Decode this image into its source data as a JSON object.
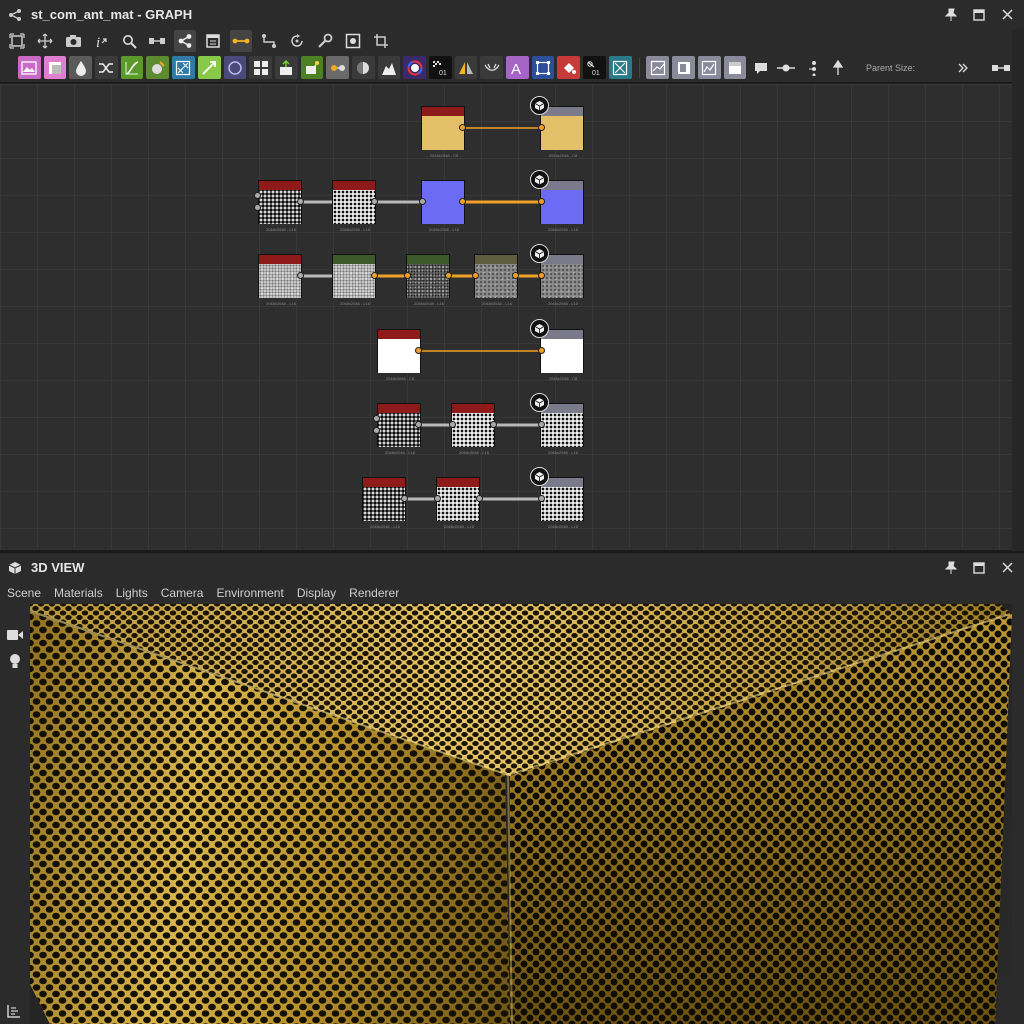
{
  "graph_panel": {
    "title": "st_com_ant_mat - GRAPH",
    "icon": "graph-icon",
    "parent_size_label": "Parent Size:"
  },
  "toolbar_main": {
    "buttons": [
      "frame-all-icon",
      "fit-icon",
      "camera-icon",
      "info-icon",
      "search-icon",
      "layout-icon",
      "share-graph-icon",
      "frame-icon",
      "link-curve-icon",
      "link-angle-icon",
      "rotate-icon",
      "wrench-icon",
      "snapshot-icon",
      "crop-icon"
    ]
  },
  "toolbar_palette": {
    "items": [
      "image-icon",
      "uniform-color-icon",
      "levels-icon",
      "transform-icon",
      "curve-icon",
      "blend-icon",
      "warp-icon",
      "gradient-icon",
      "shape-icon",
      "tile-icon",
      "fill-icon",
      "grayscale-icon",
      "slope-icon",
      "normal-icon",
      "histogram-icon",
      "color-wheel-icon",
      "bitmap-icon",
      "mirror-icon",
      "skew-icon",
      "text-icon",
      "selection-icon",
      "paint-icon",
      "value-icon",
      "fx-map-icon",
      "pixel-processor-icon",
      "input-icon",
      "output-icon",
      "function-icon",
      "comment-icon",
      "pin-icon",
      "dot-icon",
      "frame-node-icon"
    ]
  },
  "graph_nodes": {
    "rows": [
      {
        "caption_a": "2048x2048 - C8",
        "caption_b": "2048x2048 - C8"
      },
      {
        "caption_a": "2048x2048 - L16",
        "caption_b": "2048x2048 - L16",
        "caption_c": "2048x2048 - L16",
        "caption_d": "2048x2048 - L16"
      },
      {
        "caption_a": "2048x2048 - L16",
        "caption_b": "2048x2048 - L16",
        "caption_c": "2048x2048 - L16",
        "caption_d": "2048x2048 - L16",
        "caption_e": "2048x2048 - L16"
      },
      {
        "caption_a": "2048x2048 - C8",
        "caption_b": "2048x2048 - C8"
      },
      {
        "caption_a": "2048x2048 - L16",
        "caption_b": "2048x2048 - L16",
        "caption_c": "2048x2048 - L16"
      },
      {
        "caption_a": "2048x2048 - L16",
        "caption_b": "2048x2048 - L16",
        "caption_c": "2048x2048 - L16"
      }
    ]
  },
  "view_panel": {
    "title": "3D VIEW",
    "icon": "cube-icon",
    "menu": [
      "Scene",
      "Materials",
      "Lights",
      "Camera",
      "Environment",
      "Display",
      "Renderer"
    ],
    "side_tools": [
      "video-camera-icon",
      "light-bulb-icon"
    ]
  },
  "window_controls": [
    "pin-icon",
    "maximize-icon",
    "close-icon"
  ],
  "colors": {
    "header_bg": "#2b2b2b",
    "canvas_bg": "#2e2e2e",
    "link_orange": "#f5a623",
    "link_gray": "#b8b8b8",
    "node_red": "#8e1a1a",
    "node_green": "#3c5a2a",
    "node_output_gray": "#7a7a8a",
    "gold": "#c9a23d",
    "blue_normal": "#6b6bf5"
  }
}
